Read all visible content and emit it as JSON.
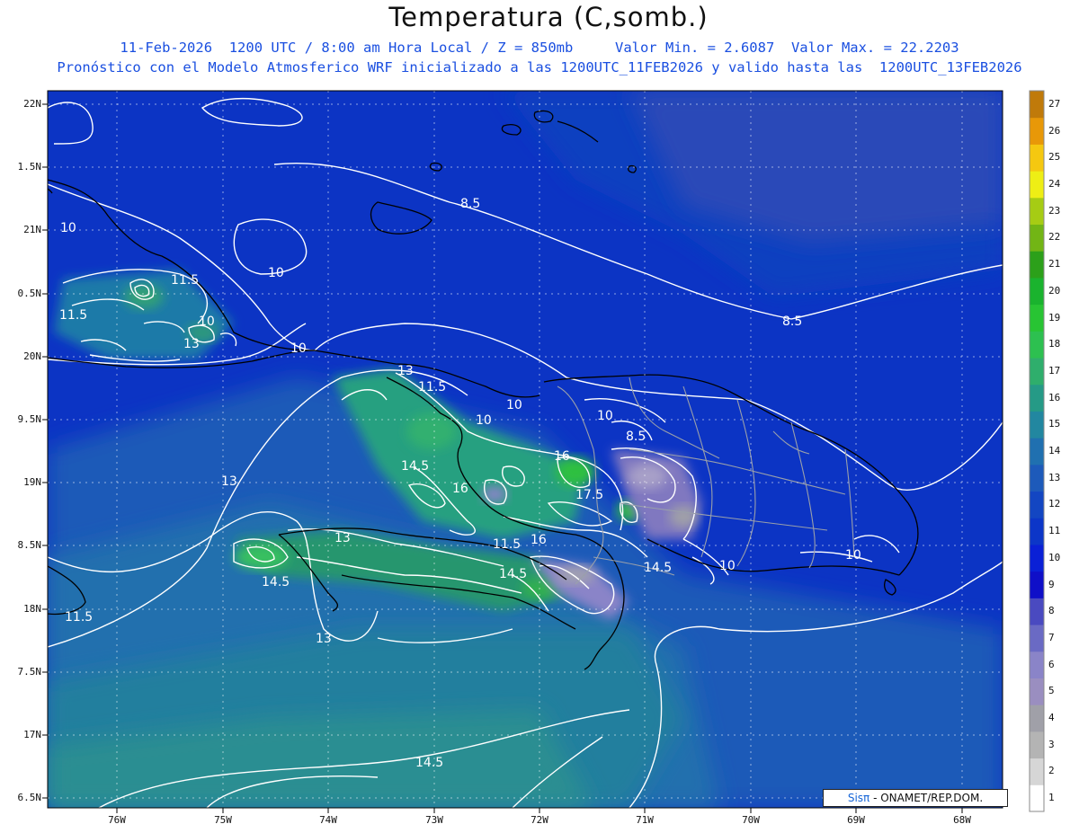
{
  "header": {
    "title": "Temperatura (C,somb.)",
    "line1": "11-Feb-2026  1200 UTC / 8:00 am Hora Local / Z = 850mb     Valor Min. = 2.6087  Valor Max. = 22.2203",
    "line2": "Pronóstico con el Modelo Atmosferico WRF inicializado a las 1200UTC_11FEB2026 y valido hasta las  1200UTC_13FEB2026"
  },
  "axes": {
    "lat_labels": [
      "22N",
      "1.5N",
      "21N",
      "0.5N",
      "20N",
      "9.5N",
      "19N",
      "8.5N",
      "18N",
      "7.5N",
      "17N",
      "6.5N"
    ],
    "lon_labels": [
      "76W",
      "75W",
      "74W",
      "73W",
      "72W",
      "71W",
      "70W",
      "69W",
      "68W"
    ]
  },
  "legend": {
    "values": [
      "1",
      "2",
      "3",
      "4",
      "5",
      "6",
      "7",
      "8",
      "9",
      "10",
      "11",
      "12",
      "13",
      "14",
      "15",
      "16",
      "17",
      "18",
      "19",
      "20",
      "21",
      "22",
      "23",
      "24",
      "25",
      "26",
      "27"
    ],
    "colors": [
      "#ffffff",
      "#d6d6d6",
      "#b4b4b4",
      "#a0a0a8",
      "#9a8ec0",
      "#8a84c8",
      "#6a6ac4",
      "#4a4ac0",
      "#0f0fc8",
      "#0a20d6",
      "#0c36c8",
      "#1346c2",
      "#1d5aba",
      "#2070b0",
      "#2287a0",
      "#259a86",
      "#2fae6c",
      "#2dc050",
      "#28c433",
      "#1ab32e",
      "#2ca01a",
      "#72b515",
      "#a6cc14",
      "#eeee15",
      "#f5c810",
      "#e89808",
      "#c07a0a"
    ]
  },
  "contour_labels": [
    "8.5",
    "8.5",
    "10",
    "10",
    "10",
    "10",
    "10",
    "10",
    "10",
    "10",
    "10",
    "11.5",
    "11.5",
    "11.5",
    "11.5",
    "13",
    "13",
    "13",
    "13",
    "13",
    "14.5",
    "14.5",
    "14.5",
    "14.5",
    "16",
    "16",
    "16",
    "17.5",
    "11.5",
    "8.5",
    "14.5"
  ],
  "credit": {
    "logo": "Sisπ",
    "text": " - ONAMET/REP.DOM."
  }
}
